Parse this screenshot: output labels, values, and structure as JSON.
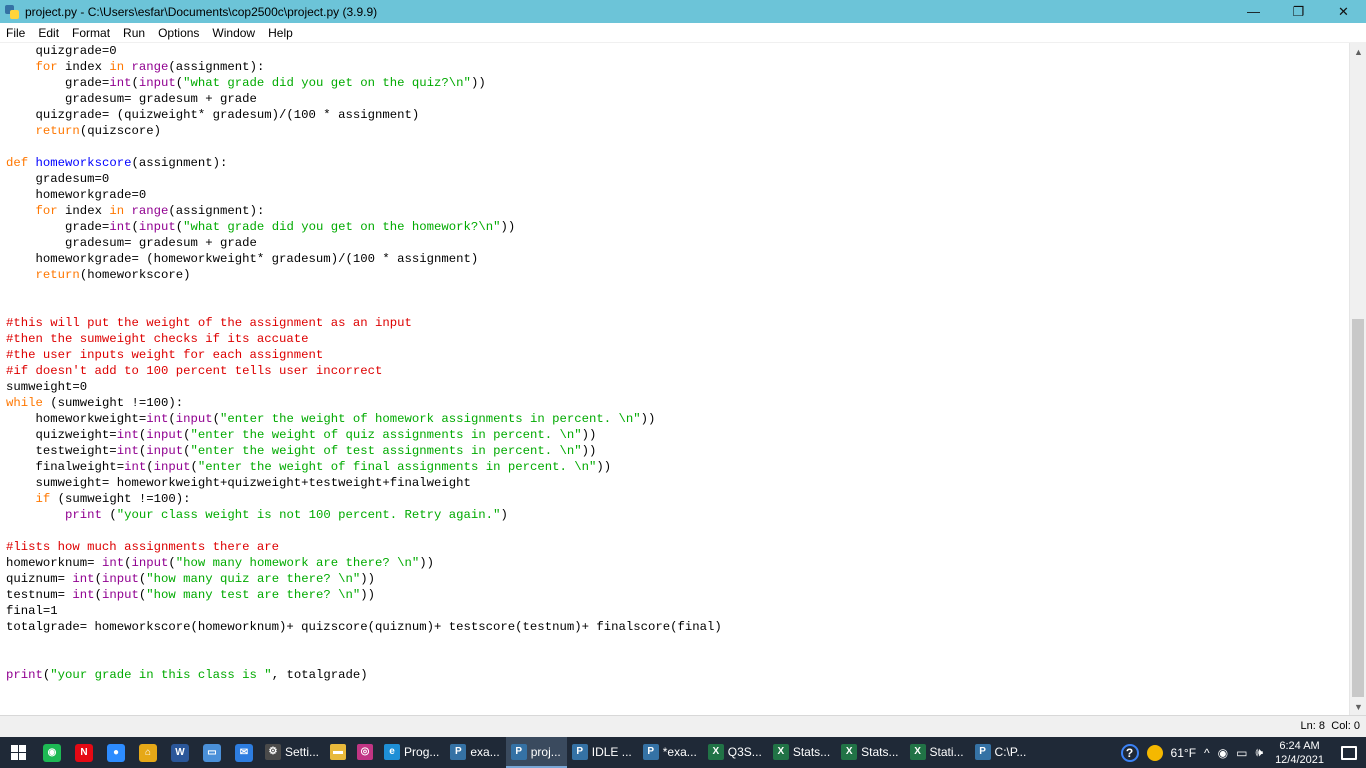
{
  "window": {
    "title": "project.py - C:\\Users\\esfar\\Documents\\cop2500c\\project.py (3.9.9)",
    "minimize": "—",
    "maximize": "❐",
    "close": "✕"
  },
  "menu": [
    "File",
    "Edit",
    "Format",
    "Run",
    "Options",
    "Window",
    "Help"
  ],
  "code_lines": [
    [
      [
        "",
        "    quizgrade=0"
      ]
    ],
    [
      [
        "",
        "    "
      ],
      [
        "kw",
        "for"
      ],
      [
        "",
        " index "
      ],
      [
        "kw",
        "in"
      ],
      [
        "",
        " "
      ],
      [
        "bi",
        "range"
      ],
      [
        "",
        "(assignment):"
      ]
    ],
    [
      [
        "",
        "        grade="
      ],
      [
        "bi",
        "int"
      ],
      [
        "",
        "("
      ],
      [
        "bi",
        "input"
      ],
      [
        "",
        "("
      ],
      [
        "st",
        "\"what grade did you get on the quiz?\\n\""
      ],
      [
        "",
        "))"
      ]
    ],
    [
      [
        "",
        "        gradesum= gradesum + grade"
      ]
    ],
    [
      [
        "",
        "    quizgrade= (quizweight* gradesum)/(100 * assignment)"
      ]
    ],
    [
      [
        "",
        "    "
      ],
      [
        "kw",
        "return"
      ],
      [
        "",
        "(quizscore)"
      ]
    ],
    [
      [
        "",
        ""
      ]
    ],
    [
      [
        "kw",
        "def"
      ],
      [
        "",
        " "
      ],
      [
        "fn",
        "homeworkscore"
      ],
      [
        "",
        "(assignment):"
      ]
    ],
    [
      [
        "",
        "    gradesum=0"
      ]
    ],
    [
      [
        "",
        "    homeworkgrade=0"
      ]
    ],
    [
      [
        "",
        "    "
      ],
      [
        "kw",
        "for"
      ],
      [
        "",
        " index "
      ],
      [
        "kw",
        "in"
      ],
      [
        "",
        " "
      ],
      [
        "bi",
        "range"
      ],
      [
        "",
        "(assignment):"
      ]
    ],
    [
      [
        "",
        "        grade="
      ],
      [
        "bi",
        "int"
      ],
      [
        "",
        "("
      ],
      [
        "bi",
        "input"
      ],
      [
        "",
        "("
      ],
      [
        "st",
        "\"what grade did you get on the homework?\\n\""
      ],
      [
        "",
        "))"
      ]
    ],
    [
      [
        "",
        "        gradesum= gradesum + grade"
      ]
    ],
    [
      [
        "",
        "    homeworkgrade= (homeworkweight* gradesum)/(100 * assignment)"
      ]
    ],
    [
      [
        "",
        "    "
      ],
      [
        "kw",
        "return"
      ],
      [
        "",
        "(homeworkscore)"
      ]
    ],
    [
      [
        "",
        ""
      ]
    ],
    [
      [
        "",
        ""
      ]
    ],
    [
      [
        "cm",
        "#this will put the weight of the assignment as an input"
      ]
    ],
    [
      [
        "cm",
        "#then the sumweight checks if its accuate"
      ]
    ],
    [
      [
        "cm",
        "#the user inputs weight for each assignment"
      ]
    ],
    [
      [
        "cm",
        "#if doesn't add to 100 percent tells user incorrect"
      ]
    ],
    [
      [
        "",
        "sumweight=0"
      ]
    ],
    [
      [
        "kw",
        "while"
      ],
      [
        "",
        " (sumweight !=100):"
      ]
    ],
    [
      [
        "",
        "    homeworkweight="
      ],
      [
        "bi",
        "int"
      ],
      [
        "",
        "("
      ],
      [
        "bi",
        "input"
      ],
      [
        "",
        "("
      ],
      [
        "st",
        "\"enter the weight of homework assignments in percent. \\n\""
      ],
      [
        "",
        "))"
      ]
    ],
    [
      [
        "",
        "    quizweight="
      ],
      [
        "bi",
        "int"
      ],
      [
        "",
        "("
      ],
      [
        "bi",
        "input"
      ],
      [
        "",
        "("
      ],
      [
        "st",
        "\"enter the weight of quiz assignments in percent. \\n\""
      ],
      [
        "",
        "))"
      ]
    ],
    [
      [
        "",
        "    testweight="
      ],
      [
        "bi",
        "int"
      ],
      [
        "",
        "("
      ],
      [
        "bi",
        "input"
      ],
      [
        "",
        "("
      ],
      [
        "st",
        "\"enter the weight of test assignments in percent. \\n\""
      ],
      [
        "",
        "))"
      ]
    ],
    [
      [
        "",
        "    finalweight="
      ],
      [
        "bi",
        "int"
      ],
      [
        "",
        "("
      ],
      [
        "bi",
        "input"
      ],
      [
        "",
        "("
      ],
      [
        "st",
        "\"enter the weight of final assignments in percent. \\n\""
      ],
      [
        "",
        "))"
      ]
    ],
    [
      [
        "",
        "    sumweight= homeworkweight+quizweight+testweight+finalweight"
      ]
    ],
    [
      [
        "",
        "    "
      ],
      [
        "kw",
        "if"
      ],
      [
        "",
        " (sumweight !=100):"
      ]
    ],
    [
      [
        "",
        "        "
      ],
      [
        "bi",
        "print"
      ],
      [
        "",
        " ("
      ],
      [
        "st",
        "\"your class weight is not 100 percent. Retry again.\""
      ],
      [
        "",
        ")"
      ]
    ],
    [
      [
        "",
        ""
      ]
    ],
    [
      [
        "cm",
        "#lists how much assignments there are"
      ]
    ],
    [
      [
        "",
        "homeworknum= "
      ],
      [
        "bi",
        "int"
      ],
      [
        "",
        "("
      ],
      [
        "bi",
        "input"
      ],
      [
        "",
        "("
      ],
      [
        "st",
        "\"how many homework are there? \\n\""
      ],
      [
        "",
        "))"
      ]
    ],
    [
      [
        "",
        "quiznum= "
      ],
      [
        "bi",
        "int"
      ],
      [
        "",
        "("
      ],
      [
        "bi",
        "input"
      ],
      [
        "",
        "("
      ],
      [
        "st",
        "\"how many quiz are there? \\n\""
      ],
      [
        "",
        "))"
      ]
    ],
    [
      [
        "",
        "testnum= "
      ],
      [
        "bi",
        "int"
      ],
      [
        "",
        "("
      ],
      [
        "bi",
        "input"
      ],
      [
        "",
        "("
      ],
      [
        "st",
        "\"how many test are there? \\n\""
      ],
      [
        "",
        "))"
      ]
    ],
    [
      [
        "",
        "final=1"
      ]
    ],
    [
      [
        "",
        "totalgrade= homeworkscore(homeworknum)+ quizscore(quiznum)+ testscore(testnum)+ finalscore(final)"
      ]
    ],
    [
      [
        "",
        ""
      ]
    ],
    [
      [
        "",
        ""
      ]
    ],
    [
      [
        "bi",
        "print"
      ],
      [
        "",
        "("
      ],
      [
        "st",
        "\"your grade in this class is \""
      ],
      [
        "",
        ", totalgrade)"
      ]
    ]
  ],
  "statusbar": {
    "line": "Ln: 8",
    "col": "Col: 0"
  },
  "scrollbar": {
    "up_arrow": "▲",
    "down_arrow": "▼"
  },
  "taskbar": {
    "pinned": [
      {
        "name": "spotify-icon",
        "glyph": "◉",
        "color": "#1db954"
      },
      {
        "name": "netflix-icon",
        "glyph": "N",
        "color": "#e50914"
      },
      {
        "name": "zoom-icon",
        "glyph": "●",
        "color": "#2d8cff"
      },
      {
        "name": "home-icon",
        "glyph": "⌂",
        "color": "#e6a817"
      },
      {
        "name": "word-icon",
        "glyph": "W",
        "color": "#2b579a"
      },
      {
        "name": "computer-icon",
        "glyph": "▭",
        "color": "#4a90d9"
      },
      {
        "name": "mail-icon",
        "glyph": "✉",
        "color": "#2d7de0"
      }
    ],
    "apps": [
      {
        "name": "settings-icon",
        "label": "Setti...",
        "glyph": "⚙",
        "color": "#4a4a4a",
        "active": false
      },
      {
        "name": "file-explorer-icon",
        "label": "",
        "glyph": "▬",
        "color": "#e8b93b",
        "active": false
      },
      {
        "name": "instagram-icon",
        "label": "",
        "glyph": "◎",
        "color": "#c13584",
        "active": false
      },
      {
        "name": "edge-icon",
        "label": "Prog...",
        "glyph": "e",
        "color": "#1e8fd6",
        "active": false
      },
      {
        "name": "python-icon",
        "label": "exa...",
        "glyph": "P",
        "color": "#3572a5",
        "active": false
      },
      {
        "name": "python-icon",
        "label": "proj...",
        "glyph": "P",
        "color": "#3572a5",
        "active": true
      },
      {
        "name": "python-icon",
        "label": "IDLE ...",
        "glyph": "P",
        "color": "#3572a5",
        "active": false
      },
      {
        "name": "python-icon",
        "label": "*exa...",
        "glyph": "P",
        "color": "#3572a5",
        "active": false
      },
      {
        "name": "excel-icon",
        "label": "Q3S...",
        "glyph": "X",
        "color": "#217346",
        "active": false
      },
      {
        "name": "excel-icon",
        "label": "Stats...",
        "glyph": "X",
        "color": "#217346",
        "active": false
      },
      {
        "name": "excel-icon",
        "label": "Stats...",
        "glyph": "X",
        "color": "#217346",
        "active": false
      },
      {
        "name": "excel-icon",
        "label": "Stati...",
        "glyph": "X",
        "color": "#217346",
        "active": false
      },
      {
        "name": "python-idle-icon",
        "label": "C:\\P...",
        "glyph": "P",
        "color": "#3572a5",
        "active": false
      }
    ],
    "tray": {
      "help": "?",
      "temperature": "61°F",
      "chevron": "^",
      "time": "6:24 AM",
      "date": "12/4/2021"
    }
  }
}
